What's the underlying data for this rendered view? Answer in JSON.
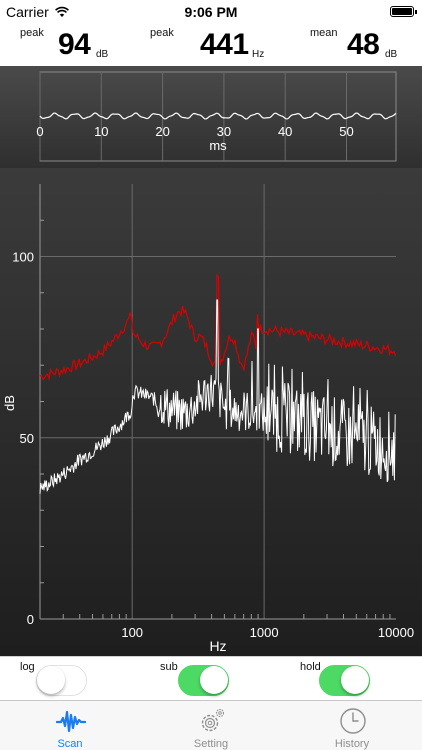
{
  "status_bar": {
    "carrier": "Carrier",
    "time": "9:06 PM"
  },
  "readouts": [
    {
      "label": "peak",
      "value": "94",
      "unit": "dB"
    },
    {
      "label": "peak",
      "value": "441",
      "unit": "Hz"
    },
    {
      "label": "mean",
      "value": "48",
      "unit": "dB"
    }
  ],
  "waveform": {
    "x_ticks": [
      "0",
      "10",
      "20",
      "30",
      "40",
      "50"
    ],
    "x_label": "ms"
  },
  "spectrum": {
    "y_ticks": [
      "0",
      "50",
      "100"
    ],
    "x_ticks": [
      "100",
      "1000",
      "10000"
    ],
    "y_label": "dB",
    "x_label": "Hz",
    "colors": {
      "peak_hold": "#d90000",
      "current": "#ffffff"
    }
  },
  "controls": [
    {
      "label": "log",
      "on": false
    },
    {
      "label": "sub",
      "on": true
    },
    {
      "label": "hold",
      "on": true
    }
  ],
  "tabs": [
    {
      "label": "Scan",
      "icon": "waveform-icon",
      "active": true
    },
    {
      "label": "Setting",
      "icon": "gear-icon",
      "active": false
    },
    {
      "label": "History",
      "icon": "clock-icon",
      "active": false
    }
  ],
  "accent_color": "#1a7cf5"
}
